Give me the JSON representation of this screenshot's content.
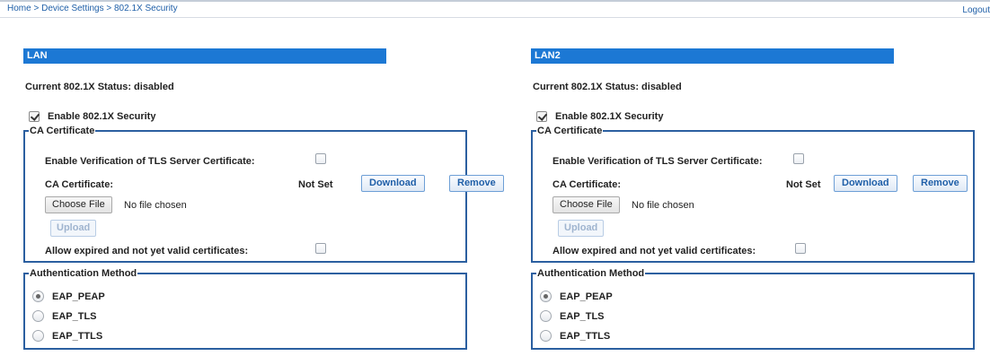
{
  "breadcrumb": {
    "home": "Home",
    "device_settings": "Device Settings",
    "current": "802.1X Security",
    "separator": ">"
  },
  "logout": "Logout",
  "panels": [
    {
      "title": "LAN",
      "status": "Current 802.1X Status: disabled",
      "enable_label": "Enable 802.1X Security",
      "enable_checked": true,
      "ca": {
        "legend": "CA Certificate",
        "verify_label": "Enable Verification of TLS Server Certificate:",
        "cert_label": "CA Certificate:",
        "cert_status": "Not Set",
        "download": "Download",
        "remove": "Remove",
        "choose_file": "Choose File",
        "no_file": "No file chosen",
        "upload": "Upload",
        "allow_label": "Allow expired and not yet valid certificates:"
      },
      "auth": {
        "legend": "Authentication Method",
        "options": [
          "EAP_PEAP",
          "EAP_TLS",
          "EAP_TTLS"
        ],
        "selected": "EAP_PEAP"
      }
    },
    {
      "title": "LAN2",
      "status": "Current 802.1X Status: disabled",
      "enable_label": "Enable 802.1X Security",
      "enable_checked": true,
      "ca": {
        "legend": "CA Certificate",
        "verify_label": "Enable Verification of TLS Server Certificate:",
        "cert_label": "CA Certificate:",
        "cert_status": "Not Set",
        "download": "Download",
        "remove": "Remove",
        "choose_file": "Choose File",
        "no_file": "No file chosen",
        "upload": "Upload",
        "allow_label": "Allow expired and not yet valid certificates:"
      },
      "auth": {
        "legend": "Authentication Method",
        "options": [
          "EAP_PEAP",
          "EAP_TLS",
          "EAP_TTLS"
        ],
        "selected": "EAP_PEAP"
      }
    }
  ],
  "colors": {
    "header_bar": "#1c78d4",
    "link": "#1f5fa8",
    "fieldset_border": "#2b5fa0"
  }
}
